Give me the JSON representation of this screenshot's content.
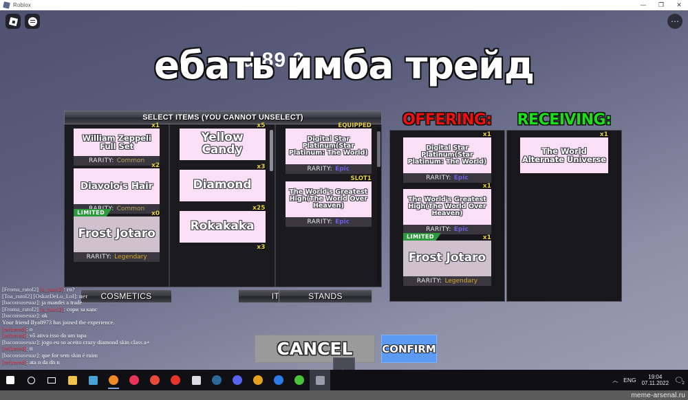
{
  "window": {
    "title": "Roblox",
    "minimize": "—",
    "maximize": "❐",
    "close": "✕"
  },
  "roblox_overlay": {
    "logo_icon": "roblox-logo-icon",
    "chat_icon": "chat-icon",
    "more_icon": "more-dots-icon",
    "background_text": "d    89 3"
  },
  "meme_caption": "ебать имба трейд",
  "inventory": {
    "header": "SELECT ITEMS (YOU CANNOT UNSELECT)",
    "columns": [
      {
        "name": "cosmetics",
        "items": [
          {
            "tag": "x1",
            "name": "William Zeppeli Full Set",
            "rarity_label": "RARITY:",
            "rarity": "Common",
            "rarity_class": "r-common",
            "limited": ""
          },
          {
            "tag": "x2",
            "name": "Diavolo's Hair",
            "rarity_label": "RARITY:",
            "rarity": "Common",
            "rarity_class": "r-common",
            "limited": ""
          },
          {
            "tag": "x0",
            "name": "Frost Jotaro",
            "rarity_label": "RARITY:",
            "rarity": "Legendary",
            "rarity_class": "r-legend",
            "limited": "LIMITED"
          }
        ]
      },
      {
        "name": "items",
        "items": [
          {
            "tag": "x5",
            "name": "Yellow Candy",
            "rarity_label": "",
            "rarity": "",
            "rarity_class": "",
            "limited": ""
          },
          {
            "tag": "x3",
            "name": "Diamond",
            "rarity_label": "",
            "rarity": "",
            "rarity_class": "",
            "limited": ""
          },
          {
            "tag": "x25",
            "name": "Rokakaka",
            "rarity_label": "",
            "rarity": "",
            "rarity_class": "",
            "limited": ""
          },
          {
            "tag": "x3",
            "name": "",
            "rarity_label": "",
            "rarity": "",
            "rarity_class": "",
            "limited": ""
          }
        ]
      },
      {
        "name": "stands",
        "items": [
          {
            "tag": "EQUIPPED",
            "name": "Digital Star Platinum(Star Platinum: The World)",
            "rarity_label": "RARITY:",
            "rarity": "Epic",
            "rarity_class": "r-epic",
            "limited": ""
          },
          {
            "tag": "SLOT1",
            "name": "The World's Greatest High(The World Over Heaven)",
            "rarity_label": "RARITY:",
            "rarity": "Epic",
            "rarity_class": "r-epic",
            "limited": ""
          }
        ]
      }
    ]
  },
  "tabs": {
    "cosmetics": "COSMETICS",
    "items": "ITEMS",
    "stands": "STANDS"
  },
  "offering": {
    "title": "OFFERING:",
    "items": [
      {
        "tag": "x1",
        "name": "Digital Star Platinum(Star Platinum: The World)",
        "rarity_label": "RARITY:",
        "rarity": "Epic",
        "rarity_class": "r-epic",
        "limited": ""
      },
      {
        "tag": "x1",
        "name": "The World's Greatest High(The World Over Heaven)",
        "rarity_label": "RARITY:",
        "rarity": "Epic",
        "rarity_class": "r-epic",
        "limited": ""
      },
      {
        "tag": "x1",
        "name": "Frost Jotaro",
        "rarity_label": "RARITY:",
        "rarity": "Legendary",
        "rarity_class": "r-legend",
        "limited": "LIMITED"
      }
    ]
  },
  "receiving": {
    "title": "RECEIVING:",
    "items": [
      {
        "tag": "x1",
        "name": "The World Alternate Universe",
        "rarity_label": "",
        "rarity": "",
        "rarity_class": "",
        "limited": ""
      }
    ]
  },
  "actions": {
    "cancel": "CANCEL",
    "confirm": "CONFIRM",
    "plus_label": "Plus"
  },
  "chat": {
    "lines": [
      [
        {
          "t": "[Froma_rutol2] ",
          "c": "c-user"
        },
        {
          "t": "[a_rutol2]",
          "c": "c-red"
        },
        {
          "t": ": го?",
          "c": "c-white"
        }
      ],
      [
        {
          "t": "[Toa_rutol2] [OskarDeLo_Lol]",
          "c": "c-user"
        },
        {
          "t": ": нет",
          "c": "c-white"
        }
      ],
      [
        {
          "t": "[baconsuseuaz]",
          "c": "c-user"
        },
        {
          "t": ": ja mandei a trade",
          "c": "c-white"
        }
      ],
      [
        {
          "t": "[Froma_rutol2] ",
          "c": "c-user"
        },
        {
          "t": "[a_rutol2]",
          "c": "c-red"
        },
        {
          "t": ": сори за капс",
          "c": "c-white"
        }
      ],
      [
        {
          "t": "[baconsuseuaz]",
          "c": "c-user"
        },
        {
          "t": ": ok",
          "c": "c-white"
        }
      ],
      [
        {
          "t": "Your friend Ilya8973 has joined the experience.",
          "c": "c-sys"
        }
      ],
      [
        {
          "t": "[refirered]",
          "c": "c-red"
        },
        {
          "t": ": o",
          "c": "c-white"
        }
      ],
      [
        {
          "t": "[refirered]",
          "c": "c-red"
        },
        {
          "t": ": vô ativa isso da um tapa",
          "c": "c-white"
        }
      ],
      [
        {
          "t": "[baconsuseuaz]",
          "c": "c-user"
        },
        {
          "t": ": jogo eu so aceito crazy diamond skin class a+",
          "c": "c-white"
        }
      ],
      [
        {
          "t": "[refirered]",
          "c": "c-red"
        },
        {
          "t": ": tt",
          "c": "c-white"
        }
      ],
      [
        {
          "t": "[baconsuseuaz]",
          "c": "c-user"
        },
        {
          "t": ": que for sem skin é ruim",
          "c": "c-white"
        }
      ],
      [
        {
          "t": "[refirered]",
          "c": "c-red"
        },
        {
          "t": ": ata n da dn n",
          "c": "c-white"
        }
      ]
    ]
  },
  "taskbar": {
    "icons": [
      {
        "name": "start-icon",
        "color": "#ffffff",
        "shape": "win"
      },
      {
        "name": "search-icon",
        "color": "#ffffff",
        "shape": "search"
      },
      {
        "name": "task-view-icon",
        "color": "#ffffff",
        "shape": "taskview"
      },
      {
        "name": "file-explorer-icon",
        "color": "#f0c24a",
        "shape": "sq"
      },
      {
        "name": "sticky-notes-icon",
        "color": "#4aa3d8",
        "shape": "sq"
      },
      {
        "name": "firefox-icon",
        "color": "#f08a24",
        "shape": "circ"
      },
      {
        "name": "opera-gx-icon",
        "color": "#e8345a",
        "shape": "circ"
      },
      {
        "name": "chrome-icon",
        "color": "#e84a3a",
        "shape": "circ"
      },
      {
        "name": "opera-icon",
        "color": "#e8342a",
        "shape": "circ"
      },
      {
        "name": "app-icon",
        "color": "#dcdce4",
        "shape": "sq"
      },
      {
        "name": "steam-icon",
        "color": "#2a6a9a",
        "shape": "circ"
      },
      {
        "name": "discord-icon",
        "color": "#5865f2",
        "shape": "circ"
      },
      {
        "name": "utorrent-icon",
        "color": "#e8a020",
        "shape": "circ"
      },
      {
        "name": "zoom-icon",
        "color": "#2a7ae8",
        "shape": "circ"
      },
      {
        "name": "utorrent2-icon",
        "color": "#4ac43a",
        "shape": "circ"
      },
      {
        "name": "roblox-taskbar-icon",
        "color": "#9a9aa8",
        "shape": "sq"
      }
    ],
    "tray": {
      "chevron": "︿",
      "language": "ENG",
      "time": "19:04",
      "date": "07.11.2022",
      "notification_icon": "notification-icon",
      "notification_count": "2"
    }
  },
  "watermark": "meme-arsenal.ru"
}
